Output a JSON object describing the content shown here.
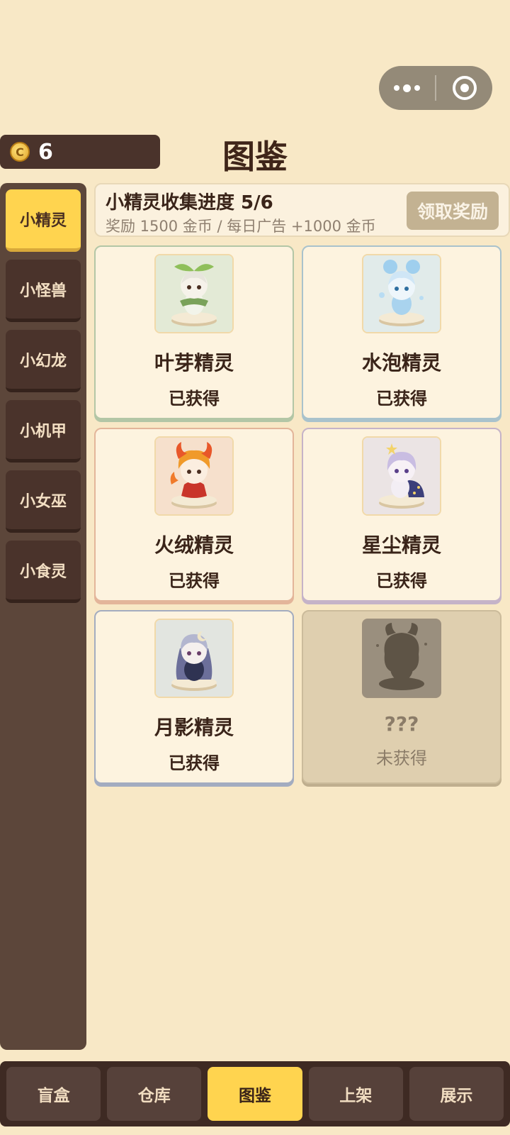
{
  "coins": {
    "icon": "coin-icon",
    "symbol": "C",
    "value": "6"
  },
  "title": "图鉴",
  "sidebar": {
    "items": [
      {
        "label": "小精灵",
        "active": true
      },
      {
        "label": "小怪兽"
      },
      {
        "label": "小幻龙"
      },
      {
        "label": "小机甲"
      },
      {
        "label": "小女巫"
      },
      {
        "label": "小食灵"
      }
    ]
  },
  "progress": {
    "title": "小精灵收集进度 5/6",
    "collected": 5,
    "total": 6,
    "subtitle": "奖励 1500 金币 / 每日广告 +1000 金币",
    "claim_label": "领取奖励"
  },
  "cards": [
    {
      "name": "叶芽精灵",
      "status": "已获得",
      "icon": "leaf-sprite-portrait",
      "accent": "#b3c6a6"
    },
    {
      "name": "水泡精灵",
      "status": "已获得",
      "icon": "bubble-sprite-portrait",
      "accent": "#a9c2cc"
    },
    {
      "name": "火绒精灵",
      "status": "已获得",
      "icon": "fire-sprite-portrait",
      "accent": "#e3b59a"
    },
    {
      "name": "星尘精灵",
      "status": "已获得",
      "icon": "stardust-sprite-portrait",
      "accent": "#c5b3c8"
    },
    {
      "name": "月影精灵",
      "status": "已获得",
      "icon": "moon-sprite-portrait",
      "accent": "#a3acc0"
    },
    {
      "name": "???",
      "status": "未获得",
      "icon": "locked-silhouette",
      "locked": true
    }
  ],
  "nav": {
    "tabs": [
      {
        "label": "盲盒"
      },
      {
        "label": "仓库"
      },
      {
        "label": "图鉴",
        "active": true
      },
      {
        "label": "上架"
      },
      {
        "label": "展示"
      }
    ]
  },
  "colors": {
    "background": "#f8e8c6",
    "accent": "#ffd44f",
    "panel_dark": "#4a332b"
  }
}
